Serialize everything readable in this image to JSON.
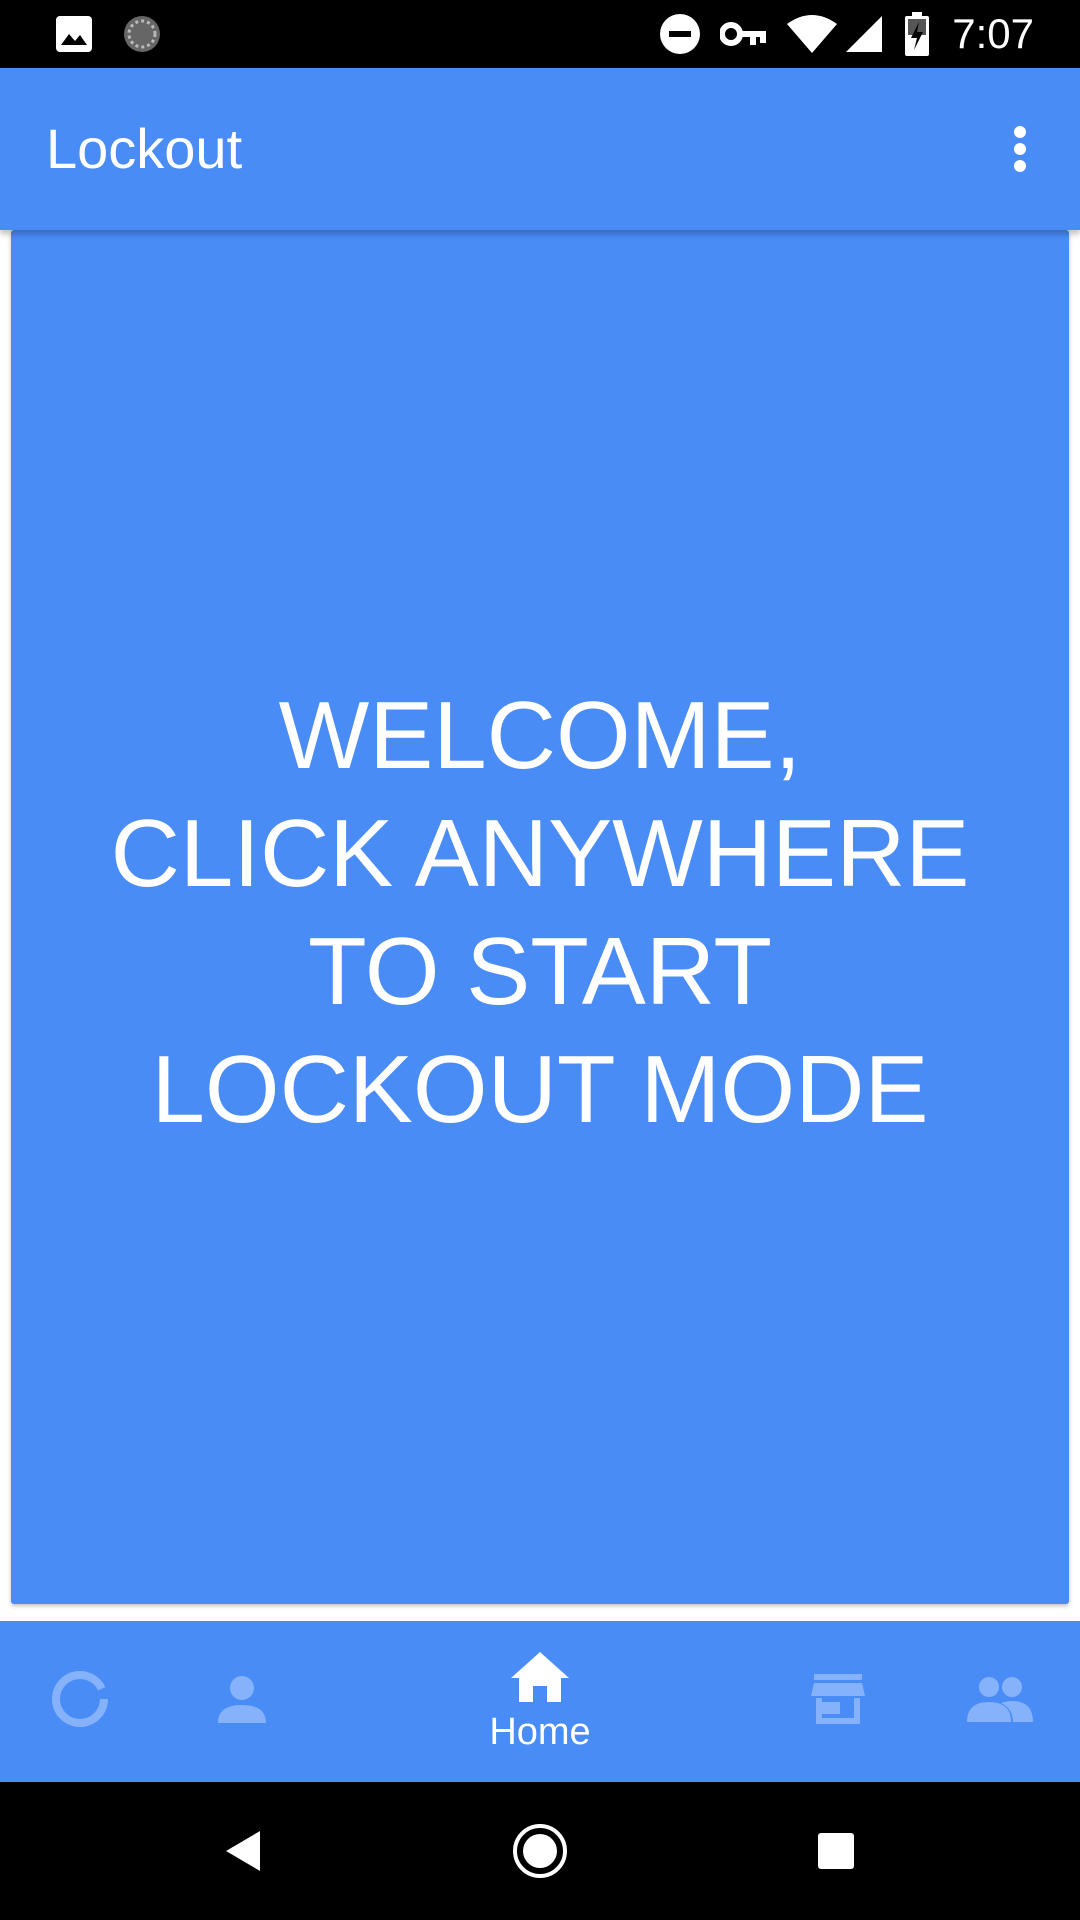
{
  "status_bar": {
    "time": "7:07",
    "icons": [
      "image-icon",
      "sync-icon",
      "do-not-disturb-icon",
      "vpn-key-icon",
      "wifi-icon",
      "cell-signal-icon",
      "battery-charging-icon"
    ]
  },
  "app_bar": {
    "title": "Lockout",
    "menu_icon": "more-vert-icon"
  },
  "main": {
    "welcome_lines": [
      "WELCOME,",
      "CLICK ANYWHERE",
      "TO START",
      "LOCKOUT MODE"
    ]
  },
  "bottom_nav": {
    "items": [
      {
        "icon": "progress-ring-icon",
        "label": "",
        "active": false
      },
      {
        "icon": "person-icon",
        "label": "",
        "active": false
      },
      {
        "icon": "home-icon",
        "label": "Home",
        "active": true
      },
      {
        "icon": "store-icon",
        "label": "",
        "active": false
      },
      {
        "icon": "people-icon",
        "label": "",
        "active": false
      }
    ]
  },
  "system_nav": {
    "buttons": [
      "back-icon",
      "home-circle-icon",
      "recents-icon"
    ]
  },
  "colors": {
    "primary": "#4a8cf6",
    "inactive_icon": "#86b2fb",
    "status_bar": "#000000"
  }
}
